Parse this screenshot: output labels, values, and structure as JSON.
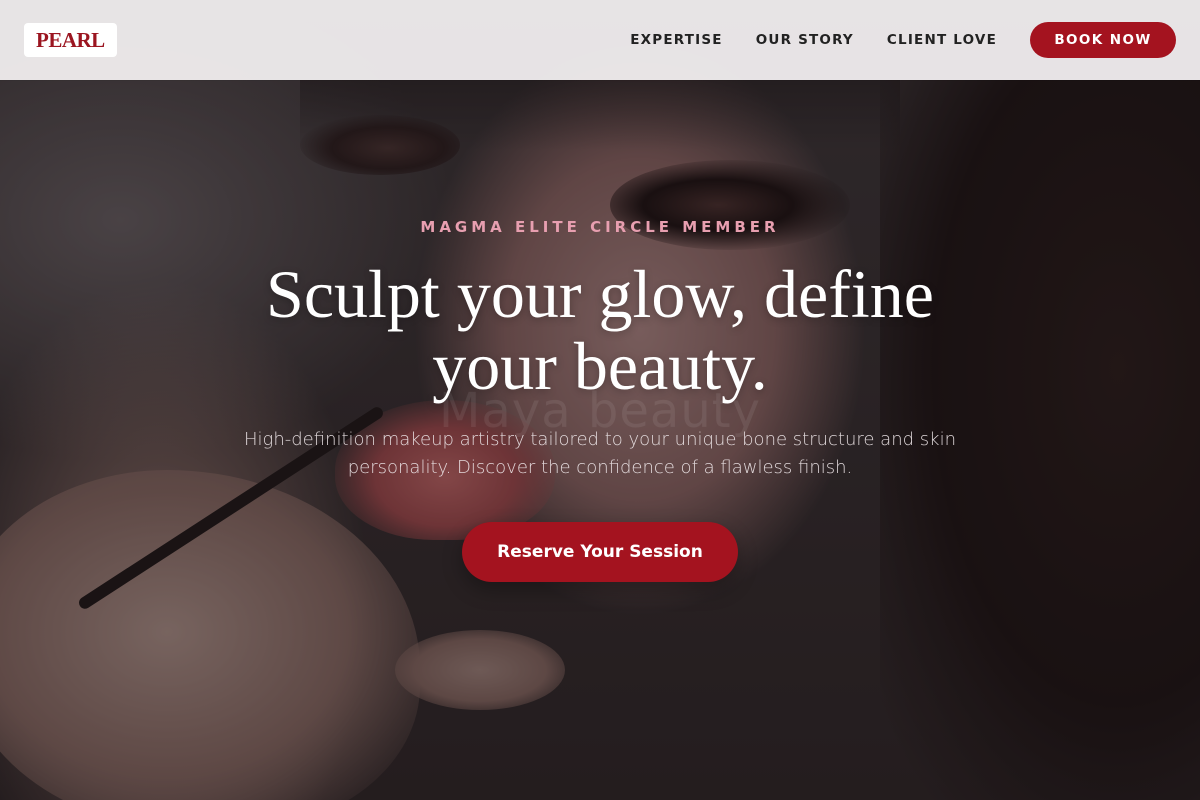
{
  "header": {
    "logo_text": "PEARL",
    "nav": [
      {
        "label": "EXPERTISE"
      },
      {
        "label": "OUR STORY"
      },
      {
        "label": "CLIENT LOVE"
      }
    ],
    "book_label": "BOOK NOW"
  },
  "hero": {
    "eyebrow": "MAGMA ELITE CIRCLE MEMBER",
    "headline": "Sculpt your glow, define your beauty.",
    "watermark": "Maya beauty",
    "subtitle": "High-definition makeup artistry tailored to your unique bone structure and skin personality. Discover the confidence of a flawless finish.",
    "cta_label": "Reserve Your Session"
  },
  "colors": {
    "brand": "#a4131f",
    "eyebrow": "#e89fb0",
    "header_bg": "#f5f2f3"
  }
}
